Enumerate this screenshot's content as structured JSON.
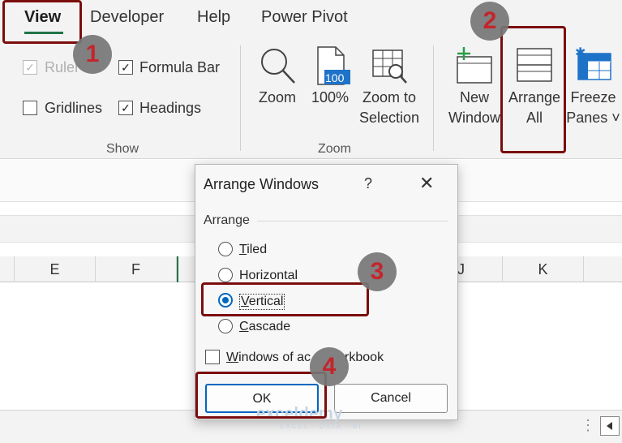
{
  "tabs": {
    "view": "View",
    "developer": "Developer",
    "help": "Help",
    "power_pivot": "Power Pivot"
  },
  "ribbon": {
    "show": {
      "ruler": "Ruler",
      "formula_bar": "Formula Bar",
      "gridlines": "Gridlines",
      "headings": "Headings",
      "group_label": "Show",
      "ruler_checked": true,
      "formula_bar_checked": true,
      "gridlines_checked": false,
      "headings_checked": true
    },
    "zoom": {
      "zoom_label": "Zoom",
      "zoom100_label": "100%",
      "zoom100_icon_text": "100",
      "zoom_sel_line1": "Zoom to",
      "zoom_sel_line2": "Selection",
      "group_label": "Zoom"
    },
    "window": {
      "new_window_line1": "New",
      "new_window_line2": "Window",
      "arrange_all_line1": "Arrange",
      "arrange_all_line2": "All",
      "freeze_line1": "Freeze",
      "freeze_line2": "Panes ˅"
    }
  },
  "columns": [
    "E",
    "F",
    "",
    "J",
    "K"
  ],
  "dialog": {
    "title": "Arrange Windows",
    "help": "?",
    "close": "✕",
    "section": "Arrange",
    "options": [
      {
        "key": "T",
        "rest": "iled",
        "selected": false
      },
      {
        "key": "",
        "rest": "Horizontal",
        "selected": false
      },
      {
        "key": "V",
        "rest": "ertical",
        "selected": true
      },
      {
        "key": "C",
        "rest": "ascade",
        "selected": false
      }
    ],
    "windows_checkbox": "Windows of active workbook",
    "windows_checkbox_prefix": "W",
    "windows_checkbox_mid": "indows of ac",
    "windows_checkbox_end": "rkbook",
    "ok": "OK",
    "cancel": "Cancel"
  },
  "annotations": {
    "badge1": "1",
    "badge2": "2",
    "badge3": "3",
    "badge4": "4",
    "highlight_color": "#7b0d0d"
  },
  "watermark": {
    "brand": "exceldemy",
    "tagline": "EXCEL · DATA · BI"
  }
}
